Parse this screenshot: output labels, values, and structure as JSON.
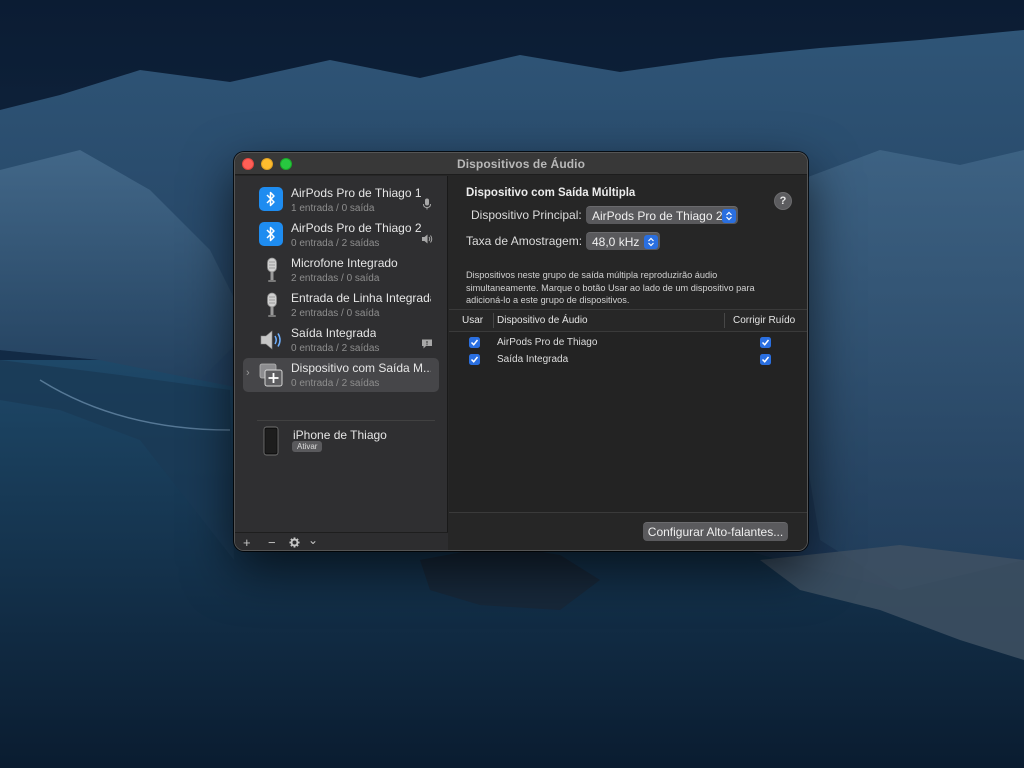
{
  "window": {
    "title": "Dispositivos de Áudio"
  },
  "sidebar": {
    "devices": [
      {
        "name": "AirPods Pro de Thiago 1",
        "sub": "1 entrada / 0 saída",
        "icon": "bluetooth-icon",
        "indicator": "microphone-icon"
      },
      {
        "name": "AirPods Pro de Thiago 2",
        "sub": "0 entrada / 2 saídas",
        "icon": "bluetooth-icon",
        "indicator": "speaker-icon"
      },
      {
        "name": "Microfone Integrado",
        "sub": "2 entradas / 0 saída",
        "icon": "microphone-device-icon"
      },
      {
        "name": "Entrada de Linha Integrada",
        "sub": "2 entradas / 0 saída",
        "icon": "microphone-device-icon"
      },
      {
        "name": "Saída Integrada",
        "sub": "0 entrada / 2 saídas",
        "icon": "speaker-device-icon",
        "indicator": "alert-bubble-icon"
      },
      {
        "name": "Dispositivo com Saída M...",
        "sub": "0 entrada / 2 saídas",
        "icon": "multi-output-icon",
        "selected": true
      }
    ],
    "iphone": {
      "name": "iPhone de Thiago",
      "action": "Ativar",
      "icon": "iphone-icon"
    },
    "toolbar": {
      "add": "+",
      "remove": "−",
      "gear_caret": "⌄"
    }
  },
  "main": {
    "heading": "Dispositivo com Saída Múltipla",
    "help": "?",
    "master_label": "Dispositivo Principal:",
    "master_value": "AirPods Pro de Thiago 2",
    "rate_label": "Taxa de Amostragem:",
    "rate_value": "48,0 kHz",
    "description": [
      "Dispositivos neste grupo de saída múltipla reproduzirão áudio",
      "simultaneamente. Marque o botão Usar ao lado de um dispositivo para",
      "adicioná-lo a este grupo de dispositivos."
    ],
    "table": {
      "headers": [
        "Usar",
        "Dispositivo de Áudio",
        "Corrigir Ruído"
      ],
      "rows": [
        {
          "use": true,
          "device": "AirPods Pro de Thiago",
          "drift": true
        },
        {
          "use": true,
          "device": "Saída Integrada",
          "drift": true
        }
      ]
    },
    "configure_button": "Configurar Alto-falantes..."
  },
  "colors": {
    "accent": "#2a6fe0",
    "bluetooth": "#1e8cf0",
    "close": "#ff5f57",
    "minimize": "#febc2e",
    "zoom": "#28c840"
  }
}
